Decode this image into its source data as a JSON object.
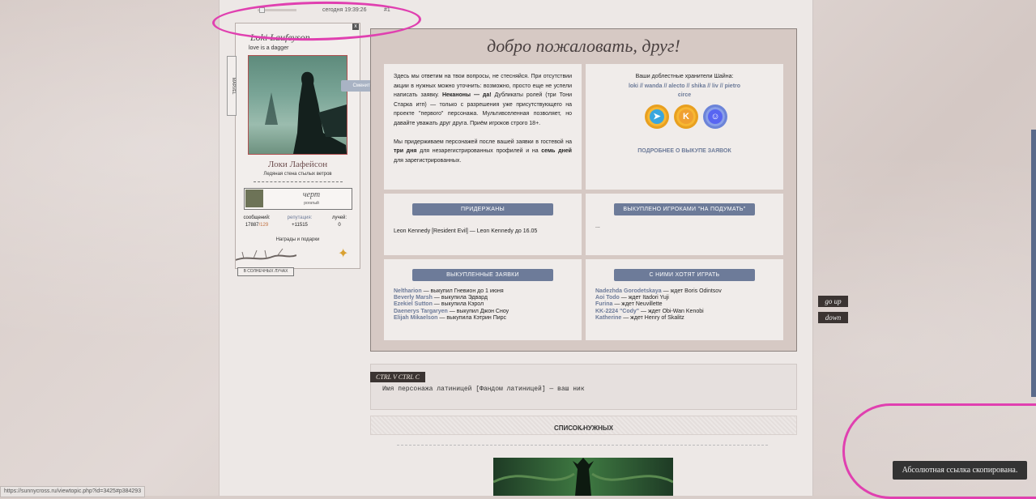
{
  "post": {
    "time": "сегодня 19:39:26",
    "number": "#1"
  },
  "profile": {
    "name": "Loki Laufeyson",
    "close_label": "x",
    "status": "love is a dagger",
    "side_tag": "MARVEL",
    "change_avatar": "Сменить аватар",
    "rus_name": "Локи Лафейсон",
    "subtitle": "Ледяная стена стылых ветров",
    "mini_title": "черт",
    "mini_sub": "рогатый",
    "stats": {
      "posts_label": "сообщений:",
      "posts_value": "17887",
      "posts_neg": "/129",
      "rep_label": "репутация:",
      "rep_value": "+11515",
      "rays_label": "лучей:",
      "rays_value": "0"
    },
    "awards": "Награды и подарки",
    "bottom_tag": "В СОЛНЕЧНЫХ ЛУЧАХ"
  },
  "welcome": {
    "title": "добро пожаловать, друг!",
    "intro_p1_a": "Здесь мы ответим на твои вопросы, не стесняйся. При отсутствии акции в нужных можно уточнить: возможно, просто еще не успели написать заявку. ",
    "intro_p1_b": "Неканоны — да!",
    "intro_p1_c": " Дубликаты ролей (три Тони Старка итп) — только с разрешения уже присутствующего на проекте \"первого\" персонажа. Мультивселенная позволяет, но давайте уважать друг друга. Приём игроков строго 18+.",
    "intro_p2_a": "Мы придерживаем персонажей после вашей заявки в гостевой на ",
    "intro_p2_b": "три дня",
    "intro_p2_c": " для незарегистрированных профилей и на ",
    "intro_p2_d": "семь дней",
    "intro_p2_e": " для зарегистрированных.",
    "keepers_label": "Ваши доблестные хранители Шайна:",
    "keepers_line1": "loki // wanda // alecto // shika // liv // pietro",
    "keepers_line2": "circe",
    "more_link": "ПОДРОБНЕЕ О ВЫКУПЕ ЗАЯВОК",
    "held_header": "ПРИДЕРЖАНЫ",
    "held_text": "Leon Kennedy [Resident Evil] — Leon Kennedy до 16.05",
    "thinking_header": "ВЫКУПЛЕНО ИГРОКАМИ \"НА ПОДУМАТЬ\"",
    "thinking_text": "...",
    "bought_header": "ВЫКУПЛЕННЫЕ ЗАЯВКИ",
    "bought": [
      {
        "name": "Neltharion",
        "rest": " — выкупил Гневион до 1 июня"
      },
      {
        "name": "Beverly Marsh",
        "rest": " — выкупила Эдвард"
      },
      {
        "name": "Ezekiel Sutton",
        "rest": " — выкупила Кэрол"
      },
      {
        "name": "Daenerys Targaryen",
        "rest": " — выкупил Джон Сноу"
      },
      {
        "name": "Elijah Mikaelson",
        "rest": " — выкупила Кэтрин Пирс"
      }
    ],
    "want_header": "С НИМИ ХОТЯТ ИГРАТЬ",
    "want": [
      {
        "name": "Nadezhda Gorodetskaya",
        "rest": " — ждет Boris Odintsov"
      },
      {
        "name": "Aoi Todo",
        "rest": " — ждет Itadori Yuji"
      },
      {
        "name": "Furina",
        "rest": " — ждет Neuvillette"
      },
      {
        "name": "KK-2224 \"Cody\"",
        "rest": " — ждет Obi-Wan Kenobi"
      },
      {
        "name": "Katherine",
        "rest": " — ждет Henry of Skalitz"
      }
    ]
  },
  "ctrl": {
    "tag": "CTRL V CTRL C",
    "text": "Имя персонажа латиницей [Фандом латиницей] — ваш ник"
  },
  "needed": {
    "label": "СПИСОК НУЖНЫХ"
  },
  "nav": {
    "up": "go up",
    "down": "down"
  },
  "toast": "Абсолютная ссылка скопирована.",
  "status_url": "https://sunnycross.ru/viewtopic.php?id=3425#p384293",
  "colors": {
    "accent": "#6d7b99",
    "annotation": "#e040b0"
  }
}
